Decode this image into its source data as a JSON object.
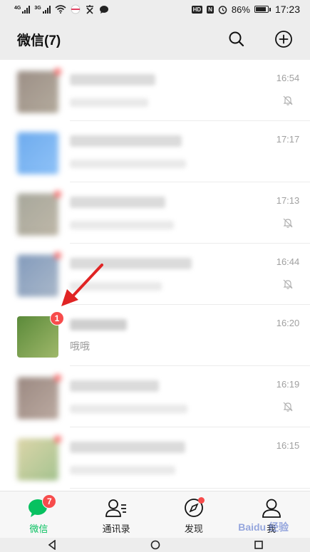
{
  "status_bar": {
    "signal1_label": "4G",
    "signal2_label": "3G",
    "chip_hd": "HD",
    "chip_n": "N",
    "battery_text": "86%",
    "battery_level": 0.86,
    "time": "17:23"
  },
  "header": {
    "title": "微信(7)",
    "search_icon": "search-icon",
    "add_icon": "plus-circle-icon"
  },
  "chats": [
    {
      "time": "16:54",
      "muted": true,
      "has_dot": true,
      "avatar_colors": [
        "#7b6a5e",
        "#9b8f7d"
      ]
    },
    {
      "time": "17:17",
      "muted": false,
      "has_dot": false,
      "avatar_colors": [
        "#3d8fe8",
        "#6aaef5"
      ]
    },
    {
      "time": "17:13",
      "muted": true,
      "has_dot": true,
      "avatar_colors": [
        "#8a8a7a",
        "#a9a08c"
      ]
    },
    {
      "time": "16:44",
      "muted": true,
      "has_dot": true,
      "avatar_colors": [
        "#5a7aa6",
        "#8da0b8"
      ]
    },
    {
      "time": "16:20",
      "muted": false,
      "badge": "1",
      "preview": "哦哦",
      "avatar_colors": [
        "#5b8a3a",
        "#9fb86a"
      ]
    },
    {
      "time": "16:19",
      "muted": true,
      "has_dot": true,
      "avatar_colors": [
        "#7a6258",
        "#a58e82"
      ]
    },
    {
      "time": "16:15",
      "muted": false,
      "has_dot": true,
      "avatar_colors": [
        "#d0c78c",
        "#88b06c"
      ]
    }
  ],
  "tabs": [
    {
      "label": "微信",
      "icon": "chat-bubble-icon",
      "badge": "7",
      "active": true
    },
    {
      "label": "通讯录",
      "icon": "contacts-icon",
      "active": false
    },
    {
      "label": "发现",
      "icon": "compass-icon",
      "dot": true,
      "active": false
    },
    {
      "label": "我",
      "icon": "person-icon",
      "active": false
    }
  ],
  "watermark": "Baidu 经验",
  "colors": {
    "accent": "#07c160",
    "badge": "#f74c4c",
    "annotation_arrow": "#e02424",
    "background": "#ededed"
  }
}
